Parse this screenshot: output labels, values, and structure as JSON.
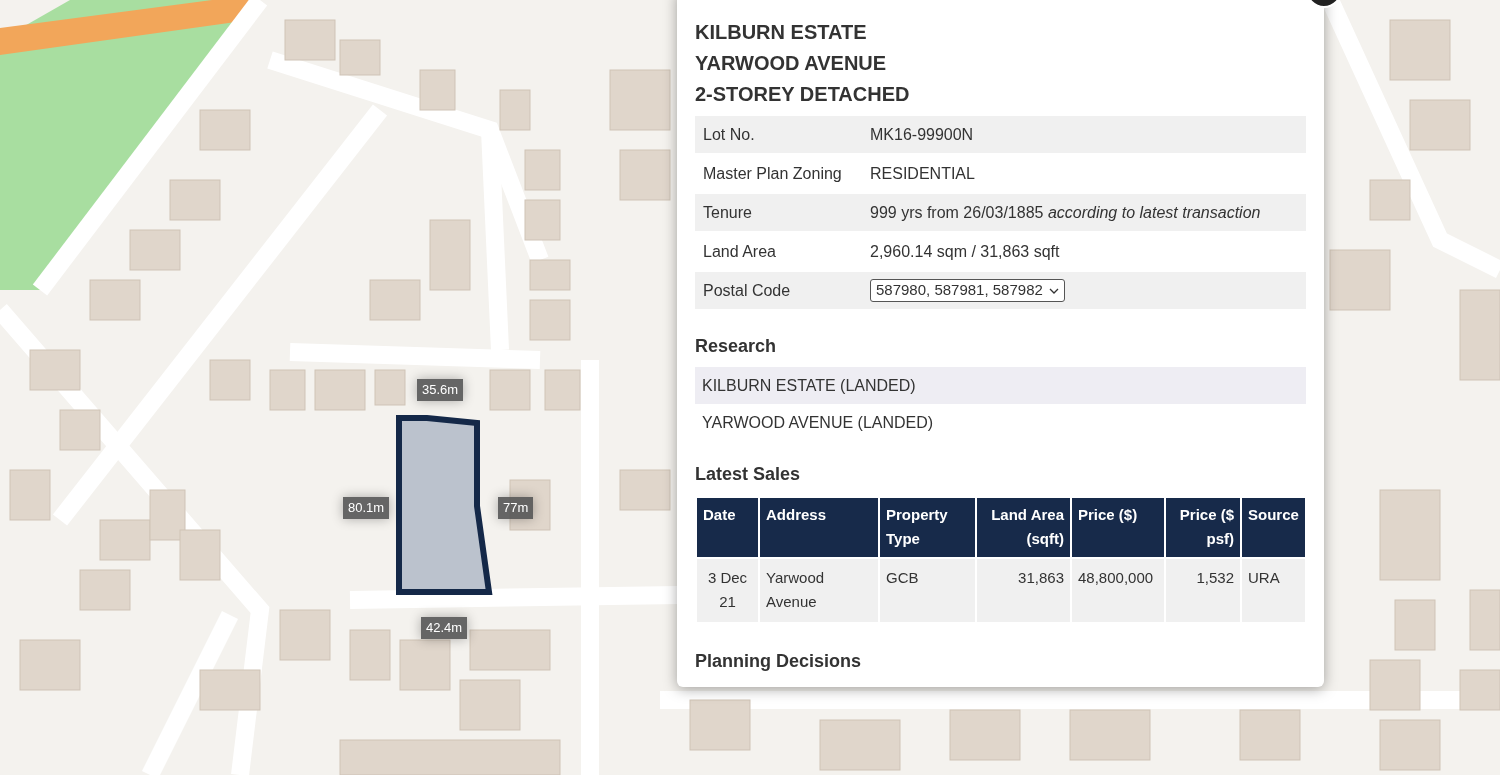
{
  "map": {
    "measurements": [
      "35.6m",
      "80.1m",
      "77m",
      "42.4m"
    ]
  },
  "popup": {
    "title_lines": [
      "KILBURN ESTATE",
      "YARWOOD AVENUE",
      "2-STOREY DETACHED"
    ],
    "details": [
      {
        "label": "Lot No.",
        "kind": "text",
        "value": "MK16-99900N"
      },
      {
        "label": "Master Plan Zoning",
        "kind": "text",
        "value": "RESIDENTIAL"
      },
      {
        "label": "Tenure",
        "kind": "text",
        "value": "999 yrs from 26/03/1885 *according to latest transaction*"
      },
      {
        "label": "Land Area",
        "kind": "text",
        "value": "2,960.14 sqm / 31,863 sqft"
      },
      {
        "label": "Postal Code",
        "kind": "select",
        "value": "587980, 587981, 587982"
      }
    ],
    "research_heading": "Research",
    "research": [
      "KILBURN ESTATE (LANDED)",
      "YARWOOD AVENUE (LANDED)"
    ],
    "sales_heading": "Latest Sales",
    "sales_table": {
      "columns": [
        "Date",
        "Address",
        "Property Type",
        "Land Area (sqft)",
        "Price ($)",
        "Price ($ psf)",
        "Source"
      ],
      "rows": [
        [
          "3 Dec 21",
          "Yarwood Avenue",
          "GCB",
          "31,863",
          "48,800,000",
          "1,532",
          "URA"
        ]
      ]
    },
    "planning_heading": "Planning Decisions"
  }
}
